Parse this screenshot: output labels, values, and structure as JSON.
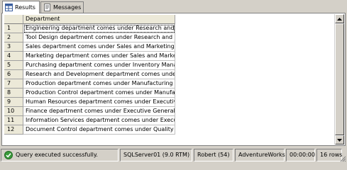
{
  "tabs": [
    {
      "label": "Results",
      "icon": "grid-icon",
      "active": true
    },
    {
      "label": "Messages",
      "icon": "messages-icon",
      "active": false
    }
  ],
  "grid": {
    "column_header": "Department",
    "rows": [
      {
        "num": "1",
        "department": "Engineering department comes under Research and De..."
      },
      {
        "num": "2",
        "department": "Tool Design department comes under Research and D..."
      },
      {
        "num": "3",
        "department": "Sales department comes under Sales and Marketing gr..."
      },
      {
        "num": "4",
        "department": "Marketing department comes under Sales and Marketin..."
      },
      {
        "num": "5",
        "department": "Purchasing department comes under Inventory Manage..."
      },
      {
        "num": "6",
        "department": "Research and Development department comes under ..."
      },
      {
        "num": "7",
        "department": "Production department comes under Manufacturing group"
      },
      {
        "num": "8",
        "department": "Production Control department comes under Manufactu..."
      },
      {
        "num": "9",
        "department": "Human Resources department comes under Executive ..."
      },
      {
        "num": "10",
        "department": "Finance department comes under Executive General an..."
      },
      {
        "num": "11",
        "department": "Information Services department comes under Executiv..."
      },
      {
        "num": "12",
        "department": "Document Control department comes under Quality Ass..."
      }
    ]
  },
  "status": {
    "message": "Query executed successfully.",
    "server": "SQLServer01 (9.0 RTM)",
    "user": "Robert (54)",
    "database": "AdventureWorks",
    "elapsed": "00:00:00",
    "rows": "16 rows"
  },
  "colors": {
    "success": "#3a9a3a",
    "window_bg": "#d4d0c8"
  }
}
